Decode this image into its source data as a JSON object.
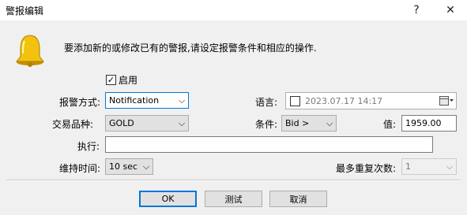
{
  "window": {
    "title": "警报编辑",
    "help_glyph": "?",
    "close_glyph": "✕"
  },
  "intro_text": "要添加新的或修改已有的警报,请设定报警条件和相应的操作.",
  "enable": {
    "label": "启用",
    "checked": true,
    "check_glyph": "✓"
  },
  "form": {
    "action_label": "报警方式:",
    "action_value": "Notification",
    "symbol_label": "交易品种:",
    "symbol_value": "GOLD",
    "execute_label": "执行:",
    "execute_value": "",
    "duration_label": "维持时间:",
    "duration_value": "10 sec",
    "language_label": "语言:",
    "expiry_value": "2023.07.17 14:17",
    "condition_label": "条件:",
    "condition_value": "Bid >",
    "value_label": "值:",
    "value_value": "1959.00",
    "max_repeat_label": "最多重复次数:",
    "max_repeat_value": "1"
  },
  "buttons": {
    "ok": "OK",
    "test": "测试",
    "cancel": "取消"
  },
  "glyphs": {
    "chevron": "⌵"
  },
  "colors": {
    "bell": "#f2c20f",
    "bell_dark": "#c49000",
    "focus": "#0078d7"
  }
}
